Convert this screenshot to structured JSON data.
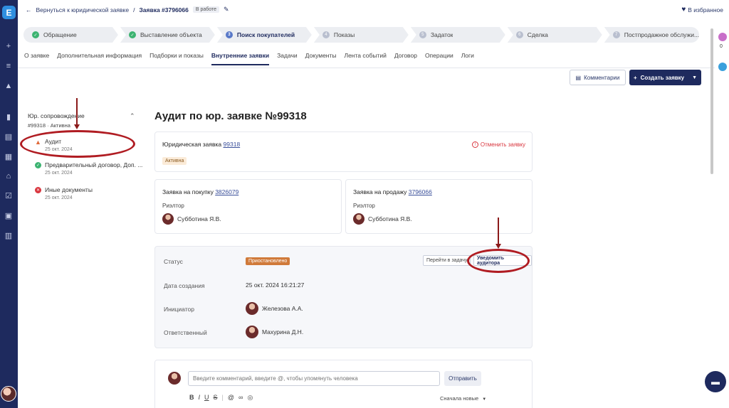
{
  "header": {
    "back_label": "Вернуться к юридической заявке",
    "separator": "/",
    "request_title": "Заявка #3796066",
    "status_badge": "В работе",
    "favorite_label": "В избранное"
  },
  "stepper": [
    {
      "label": "Обращение",
      "state": "done",
      "num": "✓"
    },
    {
      "label": "Выставление объекта",
      "state": "done",
      "num": "✓"
    },
    {
      "label": "Поиск покупателей",
      "state": "active",
      "num": "3"
    },
    {
      "label": "Показы",
      "state": "todo",
      "num": "4"
    },
    {
      "label": "Задаток",
      "state": "todo",
      "num": "5"
    },
    {
      "label": "Сделка",
      "state": "todo",
      "num": "6"
    },
    {
      "label": "Постпродажное обслужи...",
      "state": "todo",
      "num": "7"
    }
  ],
  "tabs": [
    "О заявке",
    "Дополнительная информация",
    "Подборки и показы",
    "Внутренние заявки",
    "Задачи",
    "Документы",
    "Лента событий",
    "Договор",
    "Операции",
    "Логи"
  ],
  "active_tab": "Внутренние заявки",
  "actions": {
    "comments_label": "Комментарии",
    "create_label": "Создать заявку"
  },
  "left_panel": {
    "title": "Юр. сопровождение",
    "subtitle": "#99318 · Активна",
    "items": [
      {
        "name": "Аудит",
        "date": "25 окт. 2024",
        "status": "warning"
      },
      {
        "name": "Предварительный договор, Доп. ...",
        "date": "25 окт. 2024",
        "status": "done"
      },
      {
        "name": "Иные документы",
        "date": "25 окт. 2024",
        "status": "error"
      }
    ]
  },
  "main": {
    "title": "Аудит по юр. заявке №99318",
    "legal": {
      "label": "Юридическая заявка",
      "number": "99318",
      "cancel_label": "Отменить заявку",
      "status": "Активна"
    },
    "purchase": {
      "label": "Заявка на покупку",
      "number": "3826079",
      "role": "Риэлтор",
      "person": "Субботина Я.В."
    },
    "sale": {
      "label": "Заявка на продажу",
      "number": "3796066",
      "role": "Риэлтор",
      "person": "Субботина Я.В."
    },
    "details": {
      "status_label": "Статус",
      "status_value": "Приостановлено",
      "goto_label": "Перейти в задачу",
      "notify_label": "Уведомить аудитора",
      "created_label": "Дата создания",
      "created_value": "25 окт. 2024 16:21:27",
      "initiator_label": "Инициатор",
      "initiator_value": "Железова А.А.",
      "responsible_label": "Ответственный",
      "responsible_value": "Махурина Д.Н."
    },
    "comment": {
      "placeholder": "Введите комментарий, введите @, чтобы упомянуть человека",
      "send_label": "Отправить",
      "sort_label": "Сначала новые"
    }
  },
  "rail": {
    "count": "0"
  },
  "colors": {
    "navy": "#1e2a5e",
    "done": "#3cb371",
    "warning": "#e06a3a",
    "error": "#d9363e",
    "annotation": "#b01c22",
    "paused_badge": "#d07a3a"
  }
}
